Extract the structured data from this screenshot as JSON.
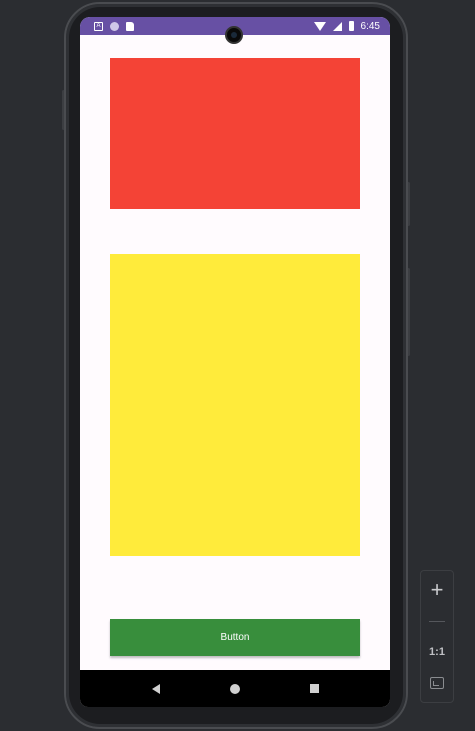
{
  "status_bar": {
    "time": "6:45",
    "left_icons": [
      "notification-a-icon",
      "circle-status-icon",
      "sd-card-icon"
    ],
    "right_icons": [
      "wifi-icon",
      "signal-icon",
      "battery-icon"
    ]
  },
  "content": {
    "red_box_color": "#f44336",
    "yellow_box_color": "#ffeb3b",
    "button_label": "Button",
    "button_color": "#388e3c"
  },
  "nav_bar": {
    "icons": [
      "back-icon",
      "home-icon",
      "recents-icon"
    ]
  },
  "zoom_toolbar": {
    "zoom_in": "+",
    "ratio_label": "1:1",
    "icons": [
      "zoom-in-icon",
      "zoom-out-icon",
      "fit-screen-icon"
    ]
  },
  "colors": {
    "accent": "#6750a4",
    "background": "#fffbfe",
    "host_background": "#2b2d31"
  }
}
